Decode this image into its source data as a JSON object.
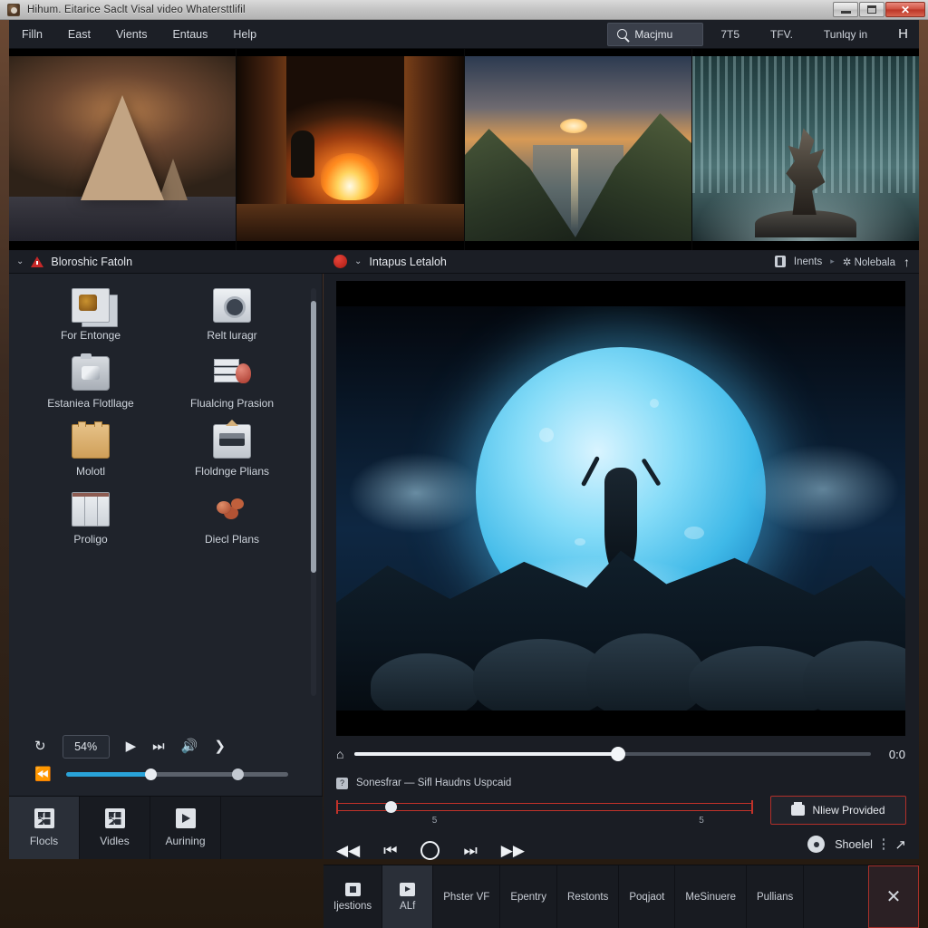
{
  "window": {
    "title": "Hihum. Eitarice Saclt Visal video Whatersttlifil",
    "app_icon": "app-logo-icon",
    "controls": {
      "minimize": "minimize-button",
      "maximize": "maximize-button",
      "close": "✕"
    }
  },
  "menubar": {
    "items": [
      "Filln",
      "East",
      "Vients",
      "Entaus",
      "Help"
    ],
    "search": {
      "value": "Macjmu",
      "placeholder": "Macjmu",
      "icon": "search-icon"
    },
    "right_items": [
      "7T5",
      "TFV.",
      "Tunlqy in"
    ],
    "right_glyph": "H"
  },
  "thumbnails": [
    {
      "name": "thumbnail-rocky-spire"
    },
    {
      "name": "thumbnail-campfire"
    },
    {
      "name": "thumbnail-fjord-sunset"
    },
    {
      "name": "thumbnail-waterfall-creature"
    }
  ],
  "panel_header": {
    "left_title": "Bloroshic Fatoln",
    "left_chevron": "⌄",
    "warning_icon": "warning-triangle-icon",
    "right_badge": "⚑",
    "right_chevron": "⌄",
    "right_title": "Intapus Letaloh",
    "far_items": {
      "inents": "Inents",
      "separator": "▸",
      "nolebala": "✲ Nolebala",
      "up_arrow": "↑"
    }
  },
  "sidebar": {
    "icons": [
      {
        "label": "For Entonge",
        "icon": "photos-icon"
      },
      {
        "label": "Relt luragr",
        "icon": "disc-icon"
      },
      {
        "label": "Estaniea Flotllage",
        "icon": "camera-icon"
      },
      {
        "label": "Flualcing Prasion",
        "icon": "stack-icon"
      },
      {
        "label": "Molotl",
        "icon": "folder-icon"
      },
      {
        "label": "Floldnge Plians",
        "icon": "screen-icon"
      },
      {
        "label": "Proligo",
        "icon": "columns-icon"
      },
      {
        "label": "Diecl Plans",
        "icon": "meat-icon"
      }
    ],
    "transport": {
      "refresh_icon": "↻",
      "percent": "54%",
      "play_icon": "▶",
      "skip_icon": "⏭",
      "volume_icon": "🔊",
      "next_icon": "❯",
      "prev_icon": "⏪"
    },
    "tabs": [
      {
        "label": "Flocls",
        "icon": "grid-icon",
        "active": true
      },
      {
        "label": "Vidles",
        "icon": "grid-icon",
        "active": false
      },
      {
        "label": "Aurining",
        "icon": "play-icon",
        "active": false
      }
    ]
  },
  "preview": {
    "scene": "moonlit-figure-on-rocks",
    "playhead": {
      "home_icon": "⌂",
      "time": "0:0",
      "progress_percent": 51
    },
    "status": {
      "badge": "?",
      "text": "Sonesfrar   — Sifl Haudns   Uspcaid"
    },
    "timeline": {
      "knob_percent": 13,
      "ticks": [
        "5",
        "5"
      ]
    },
    "transport": {
      "rewind": "◀◀",
      "prev_frame": "⏮",
      "record": "record-circle",
      "next_frame": "⏭",
      "forward": "▶▶"
    },
    "provided_button": {
      "label": "Nliew Provided",
      "icon": "printer-icon"
    },
    "shoelel": {
      "label": "Shoelel",
      "icon": "disc-small-icon"
    },
    "more_icon": "kebab-menu-icon",
    "expand_icon": "↗"
  },
  "bottom_tabs": [
    {
      "label": "Ijestions",
      "icon": "square-icon",
      "active": false
    },
    {
      "label": "ALf",
      "icon": "play-icon",
      "active": true
    },
    {
      "label": "Phster VF",
      "icon": "",
      "active": false
    },
    {
      "label": "Epentry",
      "icon": "",
      "active": false
    },
    {
      "label": "Restonts",
      "icon": "",
      "active": false
    },
    {
      "label": "Poqjaot",
      "icon": "",
      "active": false
    },
    {
      "label": "MeSinuere",
      "icon": "",
      "active": false
    },
    {
      "label": "Pullians",
      "icon": "",
      "active": false
    }
  ],
  "bottom_close": "✕",
  "colors": {
    "accent_blue": "#29a3d9",
    "accent_red": "#c1322a",
    "panel_bg": "#1f232b",
    "chrome_bg": "#1c1f26"
  }
}
